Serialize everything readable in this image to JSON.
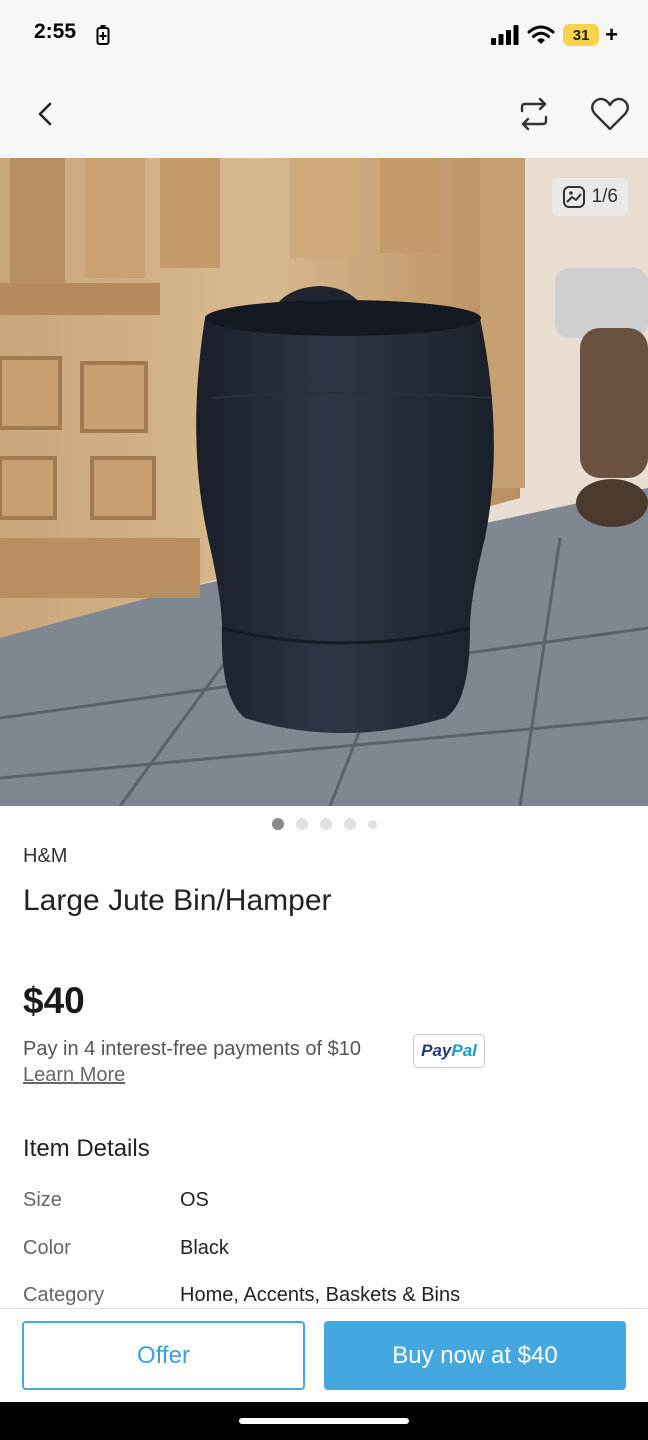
{
  "status": {
    "time": "2:55",
    "battery": "31"
  },
  "image": {
    "counter": "1/6",
    "total_dots": 5,
    "active_dot": 1
  },
  "product": {
    "brand": "H&M",
    "title": "Large Jute Bin/Hamper",
    "price": "$40",
    "installments": "Pay in 4 interest-free payments of $10",
    "paypal_pay": "Pay",
    "paypal_pal": "Pal",
    "learn_more": "Learn More"
  },
  "details": {
    "heading": "Item Details",
    "rows": [
      {
        "label": "Size",
        "value": "OS"
      },
      {
        "label": "Color",
        "value": "Black"
      },
      {
        "label": "Category",
        "value": "Home, Accents, Baskets & Bins"
      }
    ]
  },
  "actions": {
    "offer": "Offer",
    "buy": "Buy now at $40"
  },
  "colors": {
    "accent": "#45a7e0",
    "battery": "#f7d44c"
  }
}
